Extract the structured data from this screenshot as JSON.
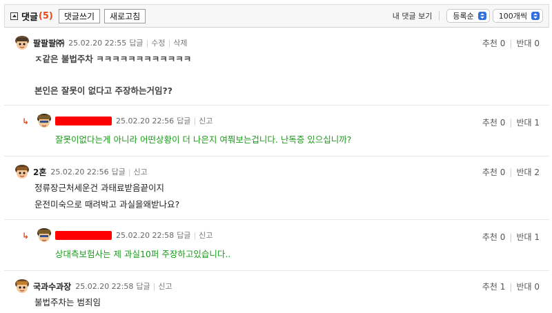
{
  "toolbar": {
    "title": "댓글",
    "count": "(5)",
    "write_button": "댓글쓰기",
    "refresh_button": "새로고침",
    "my_comments": "내 댓글 보기",
    "sort_select": "등록순",
    "per_page_select": "100개씩"
  },
  "labels": {
    "reply": "답글",
    "edit": "수정",
    "delete": "삭제",
    "report": "신고",
    "recommend": "추천",
    "oppose": "반대"
  },
  "comments": [
    {
      "nickname": "팔팔팔㈜",
      "date": "25.02.20 22:55",
      "recommend": "0",
      "oppose": "0",
      "lines": [
        "ㅈ같은 불법주차 ㅋㅋㅋㅋㅋㅋㅋㅋㅋㅋㅋㅋ",
        "",
        "본인은 잘못이 없다고 주장하는거임??"
      ]
    },
    {
      "nickname": "",
      "date": "25.02.20 22:56",
      "recommend": "0",
      "oppose": "1",
      "lines": [
        "잘못이없다는게 아니라 어떤상황이 더 나은지 여쭤보는겁니다. 난독증 있으십니까?"
      ]
    },
    {
      "nickname": "2혼",
      "date": "25.02.20 22:56",
      "recommend": "0",
      "oppose": "2",
      "lines": [
        "정류장근처세운건 과태료받음끝이지",
        "운전미숙으로 때려박고 과실을왜받나요?"
      ]
    },
    {
      "nickname": "",
      "date": "25.02.20 22:58",
      "recommend": "0",
      "oppose": "1",
      "lines": [
        "상대측보험사는 제 과실10퍼 주장하고있습니다.."
      ]
    },
    {
      "nickname": "국과수과장",
      "date": "25.02.20 22:58",
      "recommend": "1",
      "oppose": "0",
      "lines": [
        "불법주차는 범죄임"
      ]
    }
  ],
  "colors": {
    "accent_red": "#e8491d",
    "reply_green": "#1a9a1a",
    "redaction": "#ff0000",
    "select_blue": "#2f6fe0"
  },
  "icons": {
    "collapse": "collapse-icon",
    "reply_arrow": "reply-arrow-icon",
    "avatar": "avatar-icon",
    "select_arrows": "select-arrows-icon"
  }
}
